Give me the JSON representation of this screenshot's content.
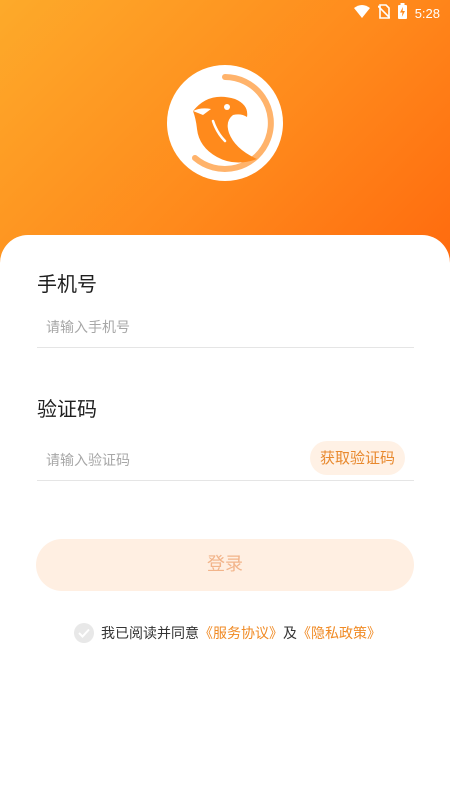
{
  "status_bar": {
    "time": "5:28",
    "icons": [
      "wifi-icon",
      "no-sim-icon",
      "battery-charging-icon"
    ]
  },
  "logo": {
    "icon": "eagle-logo-icon"
  },
  "form": {
    "phone_label": "手机号",
    "phone_placeholder": "请输入手机号",
    "code_label": "验证码",
    "code_placeholder": "请输入验证码",
    "get_code_button": "获取验证码",
    "login_button": "登录"
  },
  "agreement": {
    "prefix": "我已阅读并同意",
    "service_link": "《服务协议》",
    "and": "及",
    "privacy_link": "《隐私政策》"
  },
  "colors": {
    "gradient_start": "#FDAA2A",
    "gradient_end": "#FF6A0E",
    "accent": "#F08A24",
    "login_button_bg": "#FFEFE2",
    "code_button_bg": "#FFF1E5"
  }
}
